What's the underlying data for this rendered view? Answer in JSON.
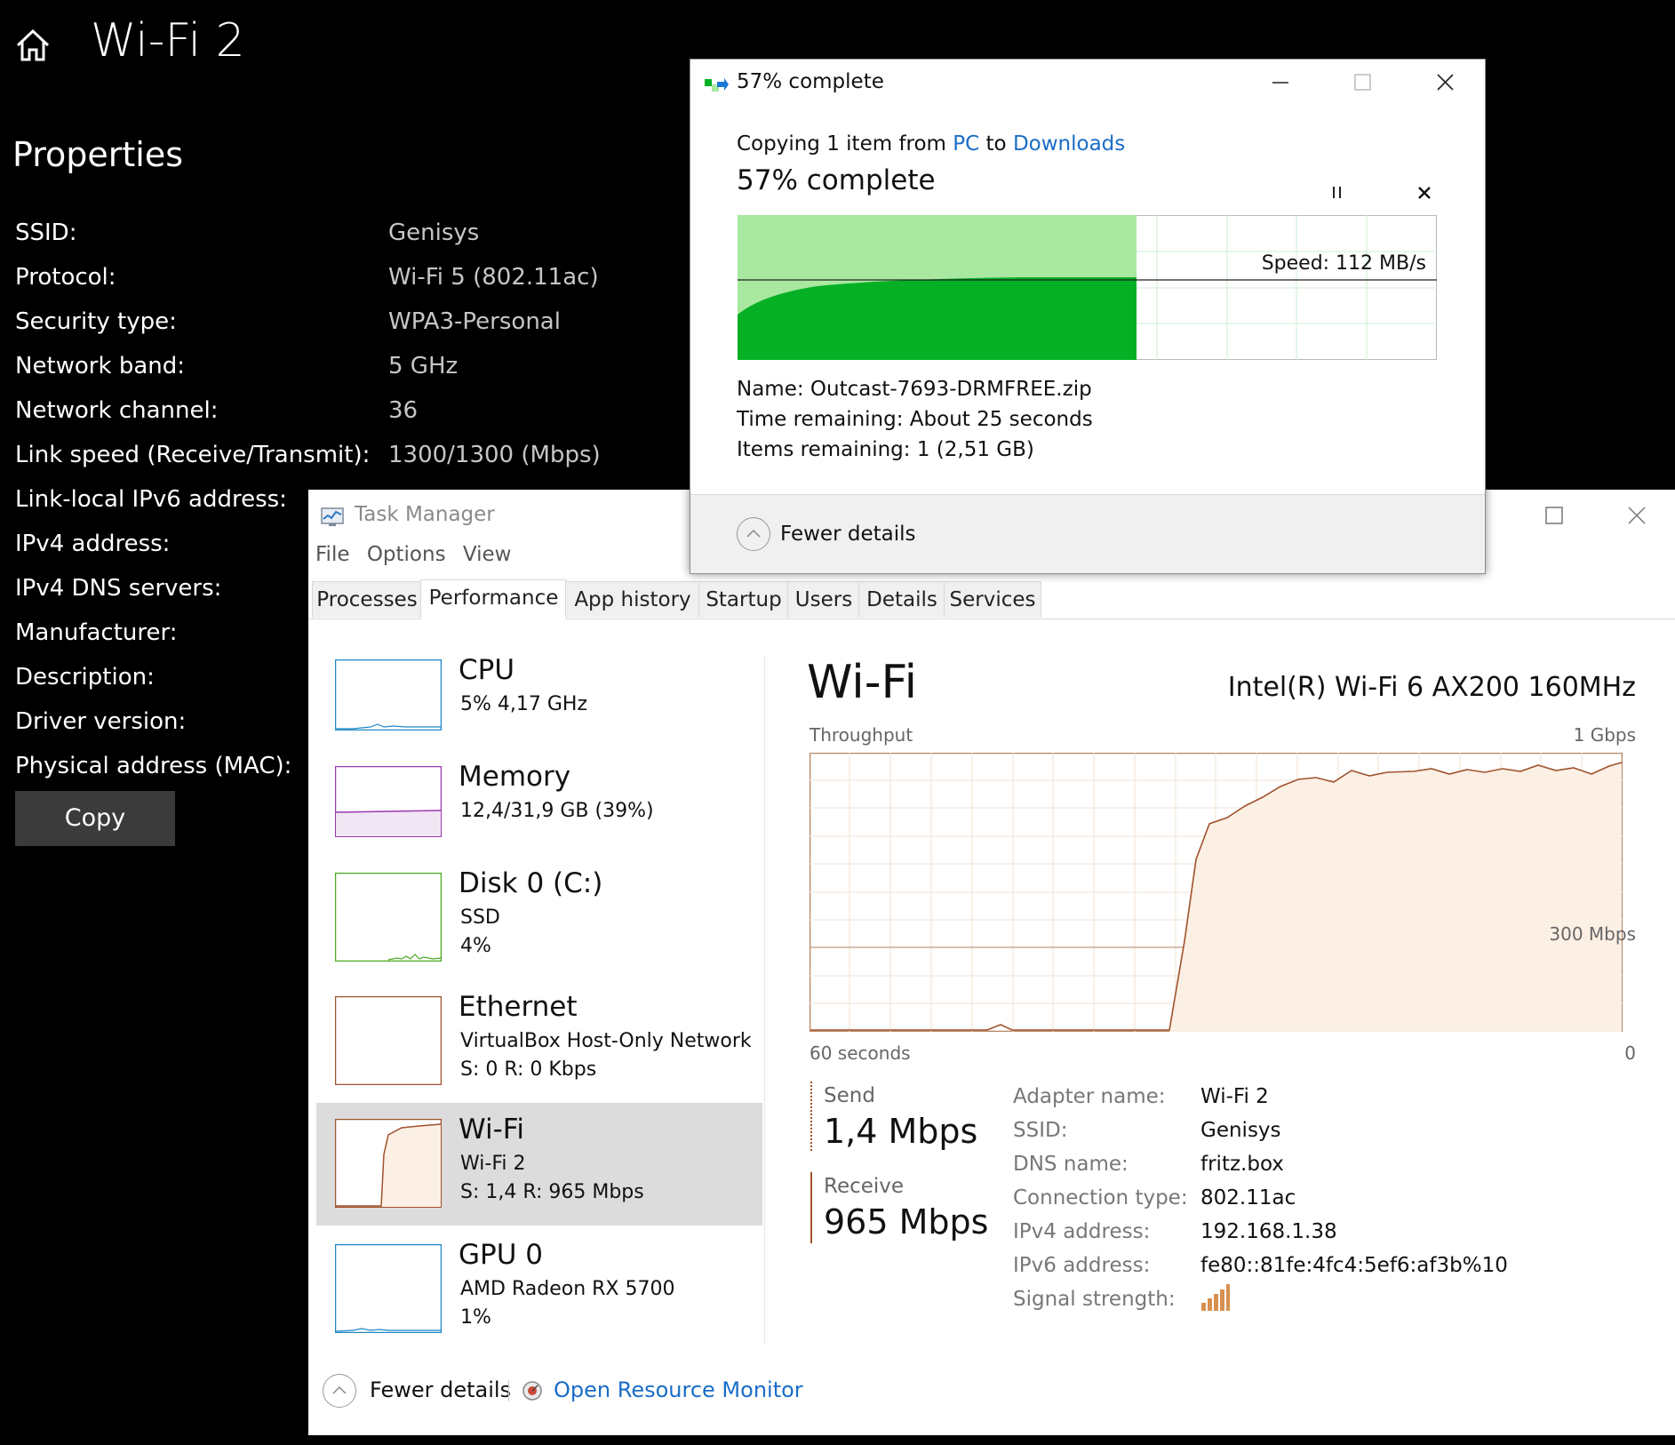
{
  "settings": {
    "title": "Wi-Fi 2",
    "properties_title": "Properties",
    "rows": [
      {
        "label": "SSID:",
        "value": "Genisys"
      },
      {
        "label": "Protocol:",
        "value": "Wi-Fi 5 (802.11ac)"
      },
      {
        "label": "Security type:",
        "value": "WPA3-Personal"
      },
      {
        "label": "Network band:",
        "value": "5 GHz"
      },
      {
        "label": "Network channel:",
        "value": "36"
      },
      {
        "label": "Link speed (Receive/Transmit):",
        "value": "1300/1300 (Mbps)"
      },
      {
        "label": "Link-local IPv6 address:",
        "value": ""
      },
      {
        "label": "IPv4 address:",
        "value": ""
      },
      {
        "label": "IPv4 DNS servers:",
        "value": ""
      },
      {
        "label": "Manufacturer:",
        "value": ""
      },
      {
        "label": "Description:",
        "value": ""
      },
      {
        "label": "Driver version:",
        "value": ""
      },
      {
        "label": "Physical address (MAC):",
        "value": ""
      }
    ],
    "copy_button": "Copy"
  },
  "task_manager": {
    "title": "Task Manager",
    "menu": [
      "File",
      "Options",
      "View"
    ],
    "tabs": [
      "Processes",
      "Performance",
      "App history",
      "Startup",
      "Users",
      "Details",
      "Services"
    ],
    "active_tab": "Performance",
    "sidebar": [
      {
        "name": "CPU",
        "lines": [
          "5%  4,17 GHz"
        ]
      },
      {
        "name": "Memory",
        "lines": [
          "12,4/31,9 GB (39%)"
        ]
      },
      {
        "name": "Disk 0 (C:)",
        "lines": [
          "SSD",
          "4%"
        ]
      },
      {
        "name": "Ethernet",
        "lines": [
          "VirtualBox Host-Only Network",
          "S: 0  R: 0 Kbps"
        ]
      },
      {
        "name": "Wi-Fi",
        "lines": [
          "Wi-Fi 2",
          "S: 1,4  R: 965 Mbps"
        ]
      },
      {
        "name": "GPU 0",
        "lines": [
          "AMD Radeon RX 5700",
          "1%"
        ]
      }
    ],
    "detail": {
      "title": "Wi-Fi",
      "adapter": "Intel(R) Wi-Fi 6 AX200 160MHz",
      "graph_label": "Throughput",
      "graph_max": "1 Gbps",
      "graph_mid": "300 Mbps",
      "graph_time": "60 seconds",
      "graph_zero": "0",
      "send_label": "Send",
      "send_value": "1,4 Mbps",
      "receive_label": "Receive",
      "receive_value": "965 Mbps",
      "info": [
        {
          "label": "Adapter name:",
          "value": "Wi-Fi 2"
        },
        {
          "label": "SSID:",
          "value": "Genisys"
        },
        {
          "label": "DNS name:",
          "value": "fritz.box"
        },
        {
          "label": "Connection type:",
          "value": "802.11ac"
        },
        {
          "label": "IPv4 address:",
          "value": "192.168.1.38"
        },
        {
          "label": "IPv6 address:",
          "value": "fe80::81fe:4fc4:5ef6:af3b%10"
        },
        {
          "label": "Signal strength:",
          "value": ""
        }
      ]
    },
    "fewer_details": "Fewer details",
    "open_resource_monitor": "Open Resource Monitor"
  },
  "copy_dialog": {
    "title": "57% complete",
    "copying_prefix": "Copying 1 item from ",
    "from": "PC",
    "to_word": " to ",
    "to": "Downloads",
    "percent_text": "57% complete",
    "progress": 0.57,
    "speed": "Speed: 112 MB/s",
    "name_label": "Name:",
    "name_value": "Outcast-7693-DRMFREE.zip",
    "time_label": "Time remaining:",
    "time_value": "About 25 seconds",
    "items_label": "Items remaining:",
    "items_value": "1 (2,51 GB)",
    "fewer_details": "Fewer details"
  },
  "colors": {
    "wifi_line": "#a0522d",
    "wifi_fill": "#fcefe4",
    "cpu": "#1e88c8",
    "memory": "#9b38b0",
    "disk": "#4aa91f",
    "copy_green": "#06b025",
    "copy_green_light": "#a8e8a0",
    "link": "#1a6dc7"
  }
}
